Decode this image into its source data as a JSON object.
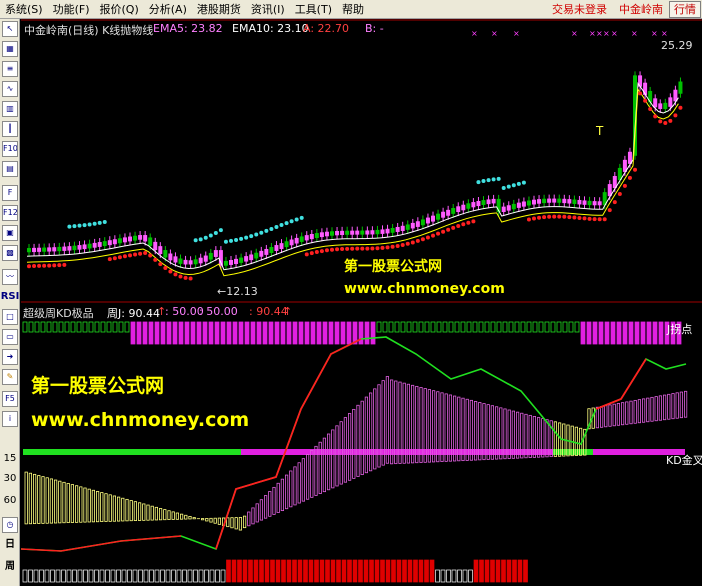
{
  "menu": {
    "items": [
      "系统(S)",
      "功能(F)",
      "报价(Q)",
      "分析(A)",
      "港股期货",
      "资讯(I)",
      "工具(T)",
      "帮助"
    ],
    "status_text": "交易未登录",
    "stock_name": "中金岭南",
    "right_tab": "行情"
  },
  "toolbar": {
    "rsi_label": "RSI",
    "f5_label": "F5",
    "numbers": [
      "15",
      "30",
      "60"
    ],
    "period_day": "日",
    "period_week": "周"
  },
  "main_panel": {
    "title": "中金岭南(日线) K线抛物线",
    "ema5_label": "EMA5: 23.82",
    "ema10_label": "EMA10: 23.10",
    "a_label": "A: 22.70",
    "b_label": "B: -",
    "high_label": "25.29",
    "low_label": "←12.13",
    "t_marker": "T"
  },
  "sub_panel": {
    "title": "超级周KD极品",
    "j_label": "周J: 90.44",
    "v1": ": 50.00",
    "v2": ": 50.00",
    "v3": ": 90.44",
    "jturn_label": "J拐点",
    "kd_cross_label": "KD金叉"
  },
  "watermarks": {
    "site_name": "第一股票公式网",
    "url": "www.chnmoney.com"
  },
  "colors": {
    "up": "#ff5cff",
    "down": "#00c000",
    "sar_up": "#ff2020",
    "sar_down": "#40e0e0",
    "ema5": "#ffffff",
    "ema10": "#ffff00",
    "j_line_up": "#ff2020",
    "j_line_down": "#20e020",
    "strip_magenta": "#e020e0",
    "strip_green": "#20e020",
    "watermark": "#ffff00"
  }
}
